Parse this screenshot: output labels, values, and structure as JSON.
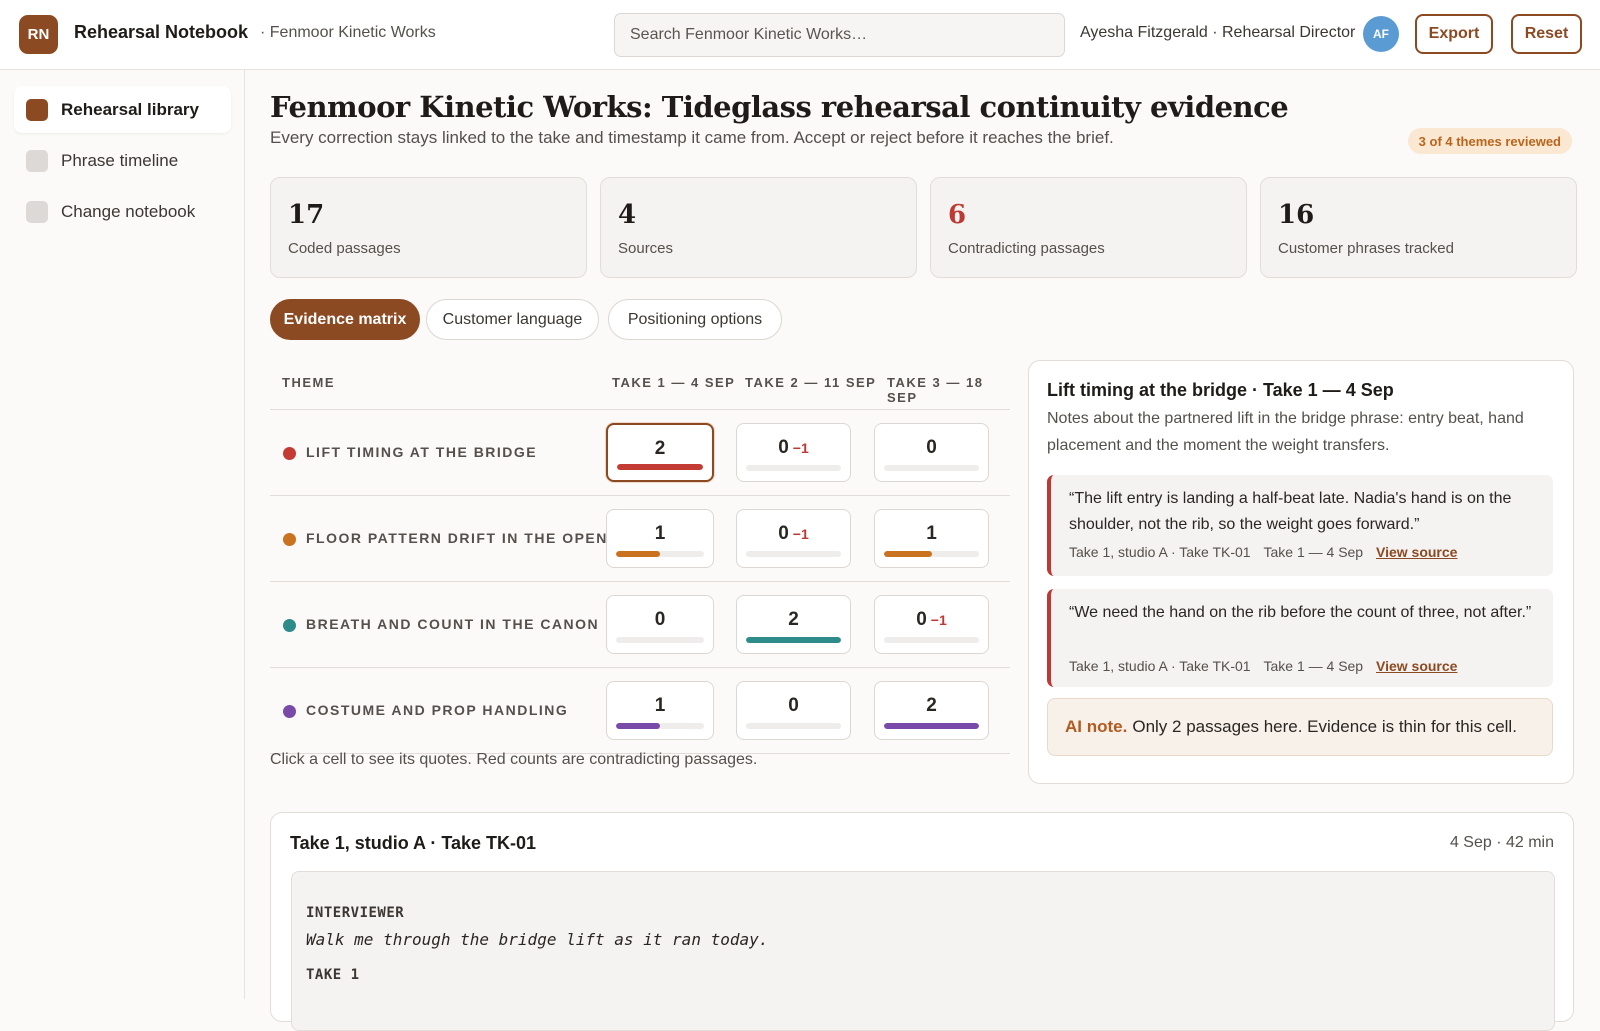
{
  "app": {
    "logo_initials": "RN",
    "title": "Rehearsal Notebook",
    "org": "· Fenmoor Kinetic Works",
    "search_placeholder": "Search Fenmoor Kinetic Works…",
    "user_label": "Ayesha Fitzgerald · Rehearsal Director",
    "user_initials": "AF",
    "export_label": "Export",
    "reset_label": "Reset"
  },
  "sidebar": {
    "items": [
      {
        "label": "Rehearsal library",
        "active": true
      },
      {
        "label": "Phrase timeline",
        "active": false
      },
      {
        "label": "Change notebook",
        "active": false
      }
    ]
  },
  "page": {
    "title": "Fenmoor Kinetic Works: Tideglass rehearsal continuity evidence",
    "subtitle": "Every correction stays linked to the take and timestamp it came from. Accept or reject before it reaches the brief.",
    "review_status": "3 of 4 themes reviewed"
  },
  "stats": [
    {
      "value": "17",
      "label": "Coded passages",
      "alert": false
    },
    {
      "value": "4",
      "label": "Sources",
      "alert": false
    },
    {
      "value": "6",
      "label": "Contradicting passages",
      "alert": true
    },
    {
      "value": "16",
      "label": "Customer phrases tracked",
      "alert": false
    }
  ],
  "tabs": [
    {
      "label": "Evidence matrix",
      "active": true
    },
    {
      "label": "Customer language",
      "active": false
    },
    {
      "label": "Positioning options",
      "active": false
    }
  ],
  "matrix": {
    "headers": {
      "theme": "THEME",
      "take1": "TAKE 1 — 4 SEP",
      "take2": "TAKE 2 — 11 SEP",
      "take3": "TAKE 3 — 18 SEP"
    },
    "rows": [
      {
        "theme": "LIFT TIMING AT THE BRIDGE",
        "color": "#c43b33",
        "cells": [
          {
            "count": "2",
            "neg": "",
            "fill": 1.0,
            "selected": true
          },
          {
            "count": "0",
            "neg": "−1",
            "fill": 0,
            "selected": false
          },
          {
            "count": "0",
            "neg": "",
            "fill": 0,
            "selected": false
          }
        ]
      },
      {
        "theme": "FLOOR PATTERN DRIFT IN THE OPENING",
        "color": "#c9721f",
        "cells": [
          {
            "count": "1",
            "neg": "",
            "fill": 0.5,
            "selected": false
          },
          {
            "count": "0",
            "neg": "−1",
            "fill": 0,
            "selected": false
          },
          {
            "count": "1",
            "neg": "",
            "fill": 0.5,
            "selected": false
          }
        ]
      },
      {
        "theme": "BREATH AND COUNT IN THE CANON",
        "color": "#2f8a8a",
        "cells": [
          {
            "count": "0",
            "neg": "",
            "fill": 0,
            "selected": false
          },
          {
            "count": "2",
            "neg": "",
            "fill": 1.0,
            "selected": false
          },
          {
            "count": "0",
            "neg": "−1",
            "fill": 0,
            "selected": false
          }
        ]
      },
      {
        "theme": "COSTUME AND PROP HANDLING",
        "color": "#7a4aa8",
        "cells": [
          {
            "count": "1",
            "neg": "",
            "fill": 0.5,
            "selected": false
          },
          {
            "count": "0",
            "neg": "",
            "fill": 0,
            "selected": false
          },
          {
            "count": "2",
            "neg": "",
            "fill": 1.0,
            "selected": false
          }
        ]
      }
    ],
    "hint": "Click a cell to see its quotes. Red counts are contradicting passages."
  },
  "detail": {
    "title": "Lift timing at the bridge · Take 1 — 4 Sep",
    "description": "Notes about the partnered lift in the bridge phrase: entry beat, hand placement and the moment the weight transfers.",
    "quotes": [
      {
        "text": "“The lift entry is landing a half-beat late. Nadia's hand is on the shoulder, not the rib, so the weight goes forward.”",
        "source": "Take 1, studio A · Take TK-01",
        "take": "Take 1 — 4 Sep",
        "link": "View source"
      },
      {
        "text": "“We need the hand on the rib before the count of three, not after.”",
        "source": "Take 1, studio A · Take TK-01",
        "take": "Take 1 — 4 Sep",
        "link": "View source"
      }
    ],
    "ai_label": "AI note.",
    "ai_text": "Only 2 passages here. Evidence is thin for this cell."
  },
  "transcript": {
    "title": "Take 1, studio A · Take TK-01",
    "meta": "4 Sep · 42 min",
    "speaker1": "INTERVIEWER",
    "line1": "Walk me through the bridge lift as it ran today.",
    "speaker2": "TAKE 1"
  }
}
